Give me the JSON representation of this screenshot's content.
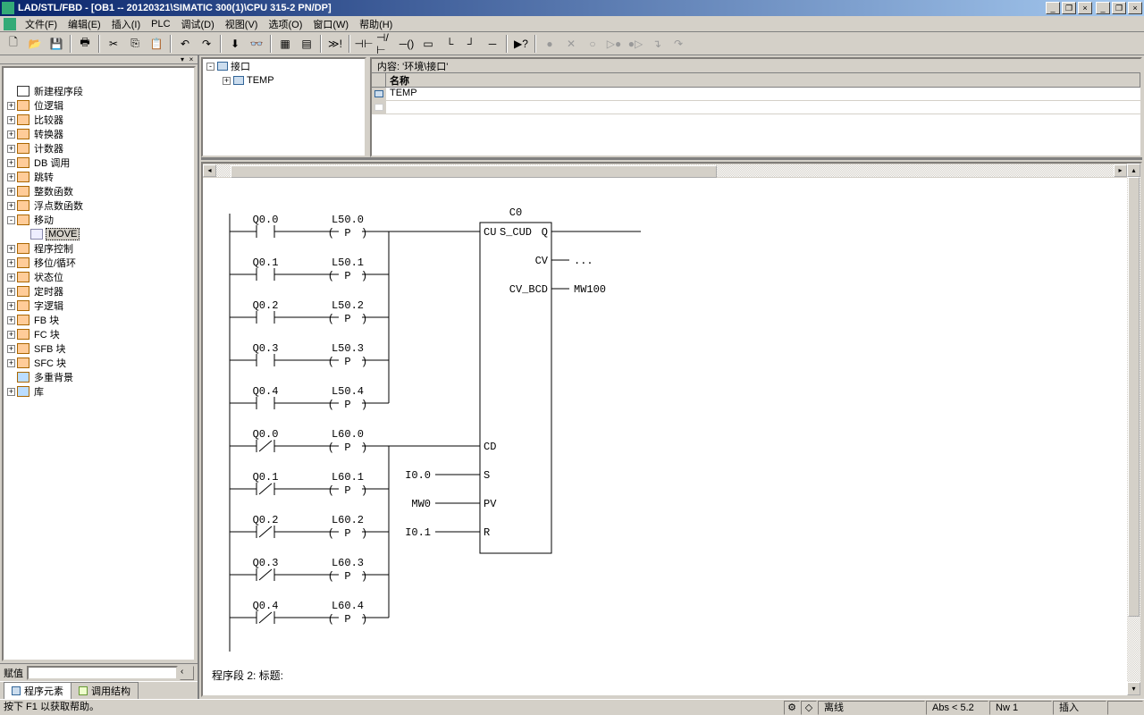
{
  "title": "LAD/STL/FBD  - [OB1 -- 20120321\\SIMATIC 300(1)\\CPU 315-2 PN/DP]",
  "menu": {
    "file": "文件(F)",
    "edit": "编辑(E)",
    "insert": "插入(I)",
    "plc": "PLC",
    "debug": "调试(D)",
    "view": "视图(V)",
    "options": "选项(O)",
    "window": "窗口(W)",
    "help": "帮助(H)"
  },
  "tree": {
    "items": [
      {
        "exp": "",
        "icon": "new",
        "label": "新建程序段"
      },
      {
        "exp": "+",
        "icon": "f",
        "label": "位逻辑"
      },
      {
        "exp": "+",
        "icon": "f",
        "label": "比较器"
      },
      {
        "exp": "+",
        "icon": "f",
        "label": "转换器"
      },
      {
        "exp": "+",
        "icon": "f",
        "label": "计数器"
      },
      {
        "exp": "+",
        "icon": "f",
        "label": "DB 调用"
      },
      {
        "exp": "+",
        "icon": "f",
        "label": "跳转"
      },
      {
        "exp": "+",
        "icon": "f",
        "label": "整数函数"
      },
      {
        "exp": "+",
        "icon": "f",
        "label": "浮点数函数"
      },
      {
        "exp": "-",
        "icon": "f",
        "label": "移动"
      },
      {
        "exp": "",
        "icon": "l",
        "label": "MOVE",
        "child": true,
        "sel": true
      },
      {
        "exp": "+",
        "icon": "f",
        "label": "程序控制"
      },
      {
        "exp": "+",
        "icon": "f",
        "label": "移位/循环"
      },
      {
        "exp": "+",
        "icon": "f",
        "label": "状态位"
      },
      {
        "exp": "+",
        "icon": "f",
        "label": "定时器"
      },
      {
        "exp": "+",
        "icon": "f",
        "label": "字逻辑"
      },
      {
        "exp": "+",
        "icon": "f",
        "label": "FB 块"
      },
      {
        "exp": "+",
        "icon": "f",
        "label": "FC 块"
      },
      {
        "exp": "+",
        "icon": "f",
        "label": "SFB 块"
      },
      {
        "exp": "+",
        "icon": "f",
        "label": "SFC 块"
      },
      {
        "exp": "",
        "icon": "m",
        "label": "多重背景"
      },
      {
        "exp": "+",
        "icon": "m",
        "label": "库"
      }
    ]
  },
  "assign": {
    "label": "赋值"
  },
  "lefttabs": {
    "t1": "程序元素",
    "t2": "调用结构"
  },
  "iface": {
    "header": "内容: '环境\\接口'",
    "col_name": "名称",
    "root": "接口",
    "temp": "TEMP",
    "row_temp": "TEMP"
  },
  "ladder": {
    "counter_name": "C0",
    "block_type": "S_CUD",
    "ports_left": [
      "CU",
      "CD",
      "S",
      "PV",
      "R"
    ],
    "ports_right": [
      "Q",
      "CV",
      "CV_BCD"
    ],
    "cv_out": "...",
    "cvbcd_out": "MW100",
    "s_in": "I0.0",
    "pv_in": "MW0",
    "r_in": "I0.1",
    "rungs_up": [
      {
        "contact": "Q0.0",
        "coil": "L50.0"
      },
      {
        "contact": "Q0.1",
        "coil": "L50.1"
      },
      {
        "contact": "Q0.2",
        "coil": "L50.2"
      },
      {
        "contact": "Q0.3",
        "coil": "L50.3"
      },
      {
        "contact": "Q0.4",
        "coil": "L50.4"
      }
    ],
    "rungs_down": [
      {
        "contact": "Q0.0",
        "coil": "L60.0"
      },
      {
        "contact": "Q0.1",
        "coil": "L60.1"
      },
      {
        "contact": "Q0.2",
        "coil": "L60.2"
      },
      {
        "contact": "Q0.3",
        "coil": "L60.3"
      },
      {
        "contact": "Q0.4",
        "coil": "L60.4"
      }
    ],
    "footer": "程序段 2: 标题:"
  },
  "status": {
    "help": "按下 F1 以获取帮助。",
    "offline": "离线",
    "abs": "Abs < 5.2",
    "nw": "Nw 1",
    "insert": "插入"
  }
}
